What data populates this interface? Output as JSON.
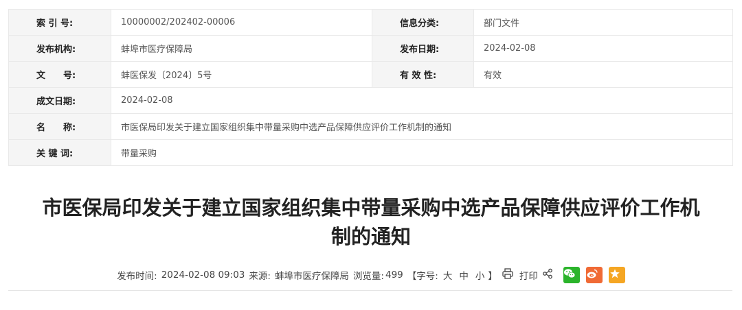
{
  "info": {
    "rows": [
      {
        "l1": "索 引 号:",
        "v1": "10000002/202402-00006",
        "l2": "信息分类:",
        "v2": "部门文件"
      },
      {
        "l1": "发布机构:",
        "v1": "蚌埠市医疗保障局",
        "l2": "发布日期:",
        "v2": "2024-02-08"
      },
      {
        "l1": "文　　号:",
        "v1": "蚌医保发〔2024〕5号",
        "l2": "有 效 性:",
        "v2": "有效"
      },
      {
        "l1": "成文日期:",
        "v1": "2024-02-08"
      },
      {
        "l1": "名　　称:",
        "v1": "市医保局印发关于建立国家组织集中带量采购中选产品保障供应评价工作机制的通知"
      },
      {
        "l1": "关 键 词:",
        "v1": "带量采购"
      }
    ]
  },
  "article": {
    "title_line1": "市医保局印发关于建立国家组织集中带量采购中选产品保障供应评价工作机",
    "title_line2": "制的通知"
  },
  "meta": {
    "publish_label": "发布时间:",
    "publish_time": "2024-02-08 09:03",
    "source_label": "来源:",
    "source": "蚌埠市医疗保障局",
    "views_label": "浏览量:",
    "views": "499",
    "font_open": "【字号:",
    "font_large": "大",
    "font_medium": "中",
    "font_small": "小",
    "font_close": "】",
    "print_label": "打印"
  },
  "colors": {
    "wechat": "#2bb42b",
    "weibo": "#f06a35",
    "favorite": "#f5a623"
  },
  "icons": [
    "printer-icon",
    "share-icon",
    "wechat-icon",
    "weibo-icon",
    "star-icon"
  ]
}
